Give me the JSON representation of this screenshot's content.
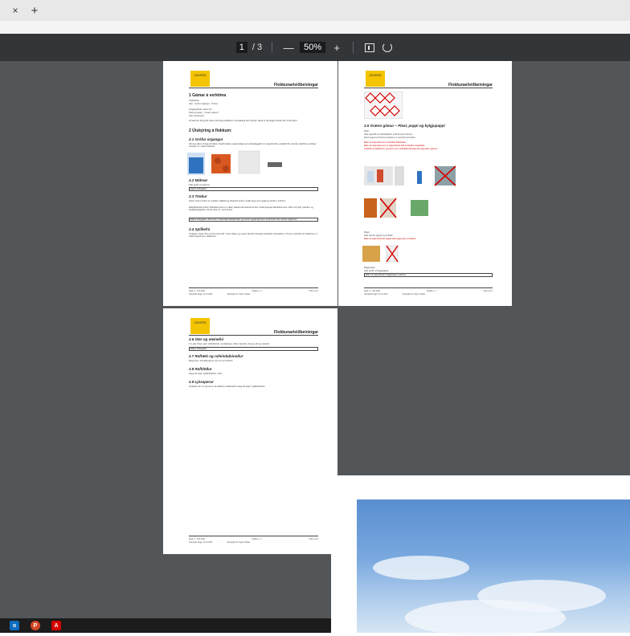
{
  "browser": {
    "close_glyph": "×",
    "new_tab_glyph": "+"
  },
  "toolbar": {
    "current_page": "1",
    "total_pages": "/ 3",
    "zoom": "50%",
    "zoom_out": "—",
    "zoom_in": "+"
  },
  "doc": {
    "logo": "JÁVERK",
    "header_title": "Flokkunarleiðbeiningar",
    "p1": {
      "h1_1": "1   Gámar á verktíma",
      "intro_1": "Opið/lokað",
      "intro_2": "Járn - Grófur úrgangur - Timbur",
      "intro_3": "Frágangshlutir, bætir við!",
      "intro_4": "Plast og pappi – „Grænn gámur\"",
      "intro_5": "Gler og steinefni",
      "intro_6": "Að auki ber ábyrg þá, tilgum að borga spilliefnum sérstaklega sem ábyrgð. Hægt er að leggja sérstök sölu innan þeirri.",
      "h1_2": "2   Útskýring á flokkum:",
      "h2_1": "2.1   Grófur úrgangur",
      "s21": "Allt sem ekki er hægt að flokka. Frauðmóttaka, pappírsafgar sem skipuléggjaðir inn: pappírsrúllur, plastáburðir, steinull, plastfilmur, gröfugir umbúðir t.d. undan bindiefni.",
      "h2_2": "2.2   Málmar",
      "s22": "Allar gerðir af málmum",
      "s22_box": "Ekkert leðrjagáfur",
      "h2_3": "2.3   Timbur",
      "s23_a": "Hreint: Hreint timbur en ómálað, ólakkað og ófúavarið timbur. Ávallt hægt vera nagla og skrúfur í timbrinu.",
      "s23_b": "Málað/blandað timbur: Blandað timbur er málað, lakkað eða fúavarið timbur meðal þessara blandaðra efna. Hlið á við skífr, plötufinn og bráðabirgðagóðar, trémál, flisa o.fl. verið timbur.",
      "s23_box": "Ekkert leðrjagáfur, Allt timbur í hvíta fleka blandið fellur og verður oppað gámnum til að timbur fari í lendu viðgefnum.",
      "h2_4": "2.4   Spilliefni",
      "s24": "Verkstjóri mætur fram við að sinnst allt í hverri skiptu og enginn þá haft á ábyrgð-verkstæði verkstæðinu. Tómum umbúðum af spilliefnum er ávallt hugsað sem spilliefnum.",
      "footer_l1": "Skjal nr.: JVK-0001",
      "footer_m1": "Útgáfa nr.: 1",
      "footer_r1": "Síða 1 af 3",
      "footer_l2": "Samþykkt dags: 22.12.2021",
      "footer_m2": "Samþykkt af: Sigrún Melax"
    },
    "p2": {
      "h2_5": "2.5   Grænn gámur – Plast, pappi og bylgjupappi",
      "plast": "Plast:",
      "s25_1": "Allar tegundir af umbúðaplasti, undir hreinum filmum.",
      "s25_2": "Dæmi tegund af hreinum plastum er sýnd hér að neðan.",
      "s25_red1": "Ekki má setja plast sem inniheldur bikblöndur.",
      "s25_red2": "Ekki má setja plast sem er mjög óhreint eða inniheldur matarleifar.",
      "s25_red3": "Umbúðir af spilliefnum og vörum sem innihalda hættuleg efni eiga ekki í gáminn.",
      "pappi": "Pappi:",
      "s25_3": "Allar hreinar pappa og umbúðir.",
      "s25_red4": "Ekki má setja óhreinan pappa eða pappa sem er blautur.",
      "bylgju": "Bylgjupappi:",
      "s25_4": "Allar gerðir af bylgjupappa.",
      "s25_box": "Ekki má setja blautan bylgjupappa í gáminn.",
      "footer_l1": "Skjal nr.: JVK-0001",
      "footer_m1": "Útgáfa nr.: 1",
      "footer_r1": "Síða 2 af 3",
      "footer_l2": "Samþykkt dags: 22.12.2021",
      "footer_m2": "Samþykkt af: Sigrún Melax"
    },
    "p3": {
      "h2_6": "2.6   Gler og steinefni",
      "s26": "T.d. gler, flísar, grjót, Hellubrotnar, mundgangur, hellur, keramik, steypa, gifs og postulín.",
      "s26_box": "Ekkert leðrjagáfur",
      "h2_7": "2.7   Raftæki og rafeindabúnaður",
      "s27": "Mega fara í sérstaka gáma, sem eru á svæðinu.",
      "h2_8": "2.8   Rafhlöður",
      "s28": "Hægt að setja í spilliefnakörfu í skúr.",
      "h2_9": "2.9   Ljósaperur",
      "s29": "Verkstjóri sér um að perum sé skilað á móttökustöð. Hægt að setja í spilliefnakörfu.",
      "footer_l1": "Skjal nr.: JVK-0001",
      "footer_m1": "Útgáfa nr.: 1",
      "footer_r1": "Síða 3 af 3",
      "footer_l2": "Samþykkt dags: 22.12.2021",
      "footer_m2": "Samþykkt af: Sigrún Melax"
    }
  },
  "taskbar": {
    "app1": "o",
    "app2": "P",
    "app3": "A"
  },
  "colors": {
    "viewer_bg": "#525659",
    "toolbar_bg": "#323639",
    "logo_yellow": "#f5c400",
    "warning_red": "#d40000"
  }
}
